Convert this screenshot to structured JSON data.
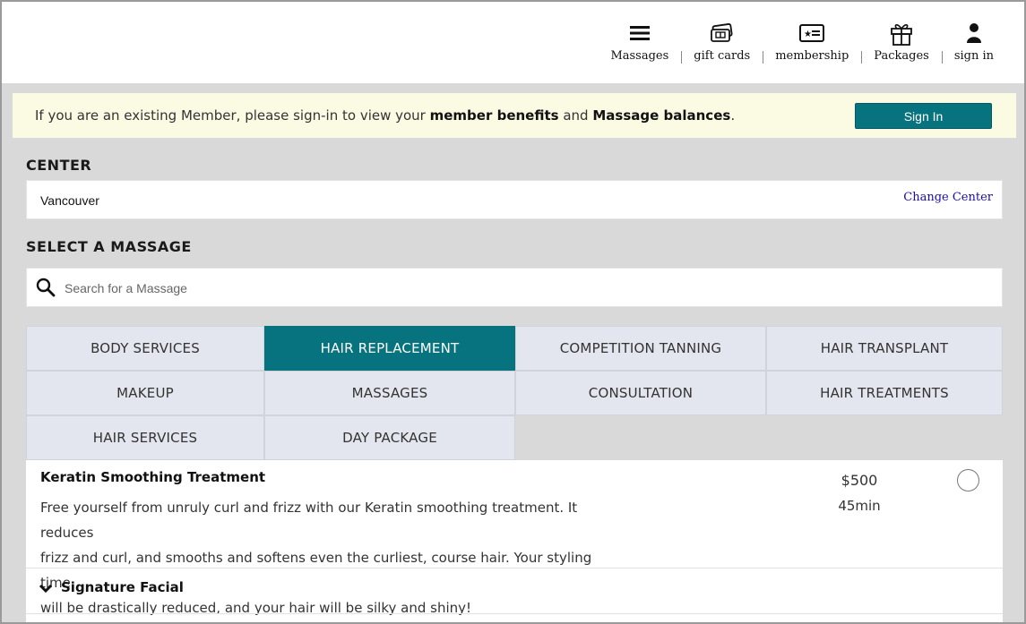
{
  "header": {
    "nav": [
      {
        "label": "Massages",
        "icon": "hamburger-menu-icon"
      },
      {
        "label": "gift cards",
        "icon": "gift-card-icon"
      },
      {
        "label": "membership",
        "icon": "membership-card-icon"
      },
      {
        "label": "Packages",
        "icon": "gift-box-icon"
      },
      {
        "label": "sign in",
        "icon": "user-icon"
      }
    ]
  },
  "banner": {
    "text_prefix": "If you are an existing Member, please sign-in to view your ",
    "bold1": "member benefits",
    "text_mid": " and ",
    "bold2": "Massage balances",
    "text_suffix": ".",
    "signin_label": "Sign In"
  },
  "center": {
    "title": "CENTER",
    "value": "Vancouver",
    "change_label": "Change Center"
  },
  "select": {
    "title": "SELECT A MASSAGE",
    "search_placeholder": "Search for a Massage"
  },
  "tabs": [
    {
      "label": "BODY SERVICES",
      "active": false
    },
    {
      "label": "HAIR REPLACEMENT",
      "active": true
    },
    {
      "label": "COMPETITION TANNING",
      "active": false
    },
    {
      "label": "HAIR TRANSPLANT",
      "active": false
    },
    {
      "label": "MAKEUP",
      "active": false
    },
    {
      "label": "MASSAGES",
      "active": false
    },
    {
      "label": "CONSULTATION",
      "active": false
    },
    {
      "label": "HAIR TREATMENTS",
      "active": false
    },
    {
      "label": "HAIR SERVICES",
      "active": false
    },
    {
      "label": "DAY PACKAGE",
      "active": false
    }
  ],
  "item": {
    "title": "Keratin Smoothing Treatment",
    "description_lines": [
      "Free yourself from unruly curl and frizz with our Keratin smoothing treatment. It reduces",
      "frizz and curl, and smooths and softens even the curliest, course hair. Your styling time",
      "will be drastically reduced, and your hair will be silky and shiny!"
    ],
    "price": "$500",
    "duration": "45min"
  },
  "group": {
    "label": "Signature Facial"
  },
  "colors": {
    "accent": "#07737f",
    "banner_bg": "#fbfae3",
    "page_bg": "#d9d9d9",
    "tab_bg": "#e3e6ee",
    "link": "#1a0dab"
  }
}
